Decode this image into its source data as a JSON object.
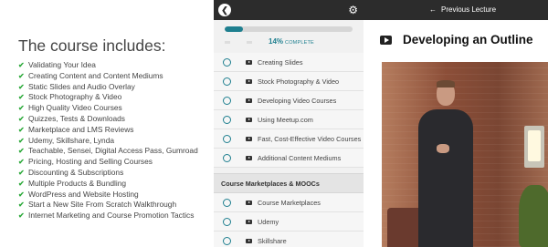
{
  "left": {
    "heading": "The course includes:",
    "features": [
      "Validating Your Idea",
      "Creating Content and Content Mediums",
      "Static Slides and Audio Overlay",
      "Stock Photography & Video",
      "High Quality Video Courses",
      "Quizzes, Tests & Downloads",
      "Marketplace and LMS Reviews",
      "Udemy, Skillshare, Lynda",
      "Teachable, Sensei, Digital Access Pass, Gumroad",
      "Pricing, Hosting and Selling Courses",
      "Discounting & Subscriptions",
      "Multiple Products & Bundling",
      "WordPress and Website Hosting",
      "Start a New Site From Scratch Walkthrough",
      "Internet Marketing and Course Promotion Tactics"
    ],
    "check_glyph": "✔"
  },
  "sidebar": {
    "back_glyph": "❮",
    "gear_glyph": "⚙",
    "progress_value": 14,
    "progress_text": "14%",
    "progress_label": "COMPLETE",
    "lessons_group1": [
      "Creating Slides",
      "Stock Photography & Video",
      "Developing Video Courses",
      "Using Meetup.com",
      "Fast, Cost-Effective Video Courses",
      "Additional Content Mediums"
    ],
    "section_title": "Course Marketplaces & MOOCs",
    "lessons_group2": [
      "Course Marketplaces",
      "Udemy",
      "Skillshare"
    ]
  },
  "player": {
    "prev_arrow": "←",
    "prev_label": "Previous Lecture",
    "title": "Developing an Outline"
  },
  "colors": {
    "accent": "#1e7f8f",
    "check": "#2eaa3c",
    "topbar": "#2c2c2c"
  }
}
